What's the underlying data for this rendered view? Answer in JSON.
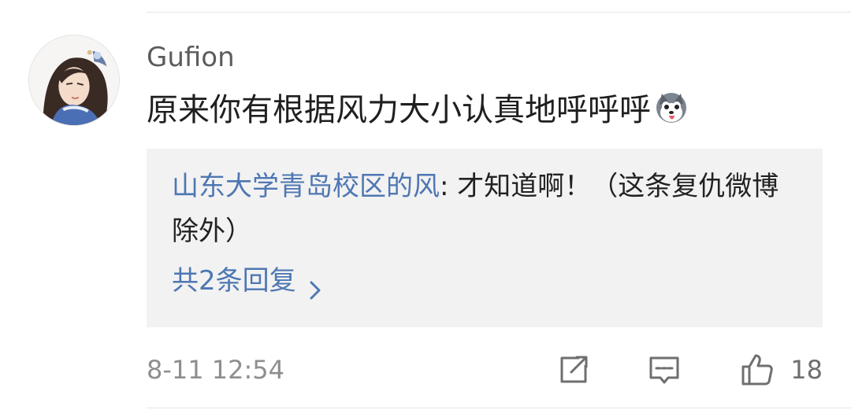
{
  "comment": {
    "username": "Gufion",
    "text": "原来你有根据风力大小认真地呼呼呼",
    "emoji": "husky-dog-emoji-icon"
  },
  "reply": {
    "author": "山东大学青岛校区的风",
    "separator": ": ",
    "text": "才知道啊！（这条复仇微博除外）",
    "more_label": "共2条回复"
  },
  "footer": {
    "timestamp": "8-11 12:54",
    "like_count": "18"
  },
  "icons": {
    "share": "share-icon",
    "comment": "comment-icon",
    "like": "thumbs-up-icon",
    "chevron": "chevron-right-icon"
  },
  "colors": {
    "link_blue": "#4e77b3",
    "reply_background": "#f2f2f2",
    "meta_gray": "#8e8e8e",
    "icon_gray": "#6f6f6f"
  }
}
